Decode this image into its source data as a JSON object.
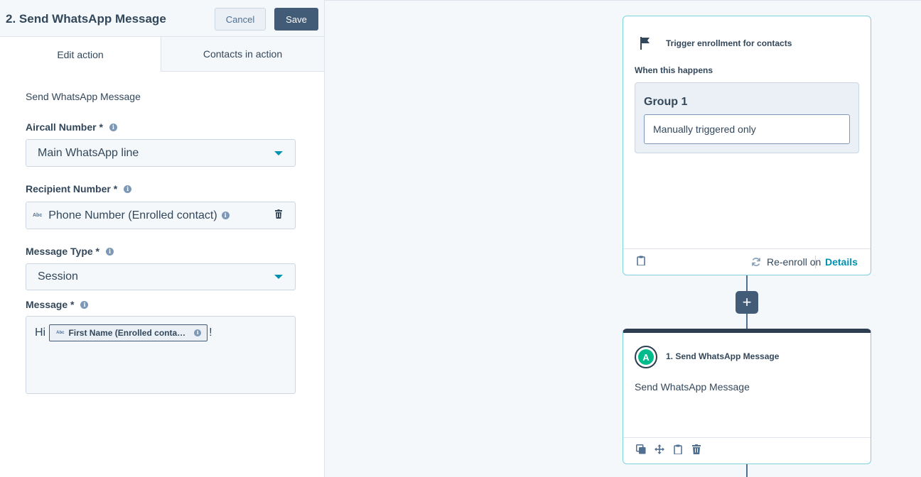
{
  "panel": {
    "title": "2. Send WhatsApp Message",
    "cancel_label": "Cancel",
    "save_label": "Save",
    "tabs": [
      {
        "label": "Edit action"
      },
      {
        "label": "Contacts in action"
      }
    ],
    "description": "Send WhatsApp Message",
    "aircall_number": {
      "label": "Aircall Number *",
      "value": "Main WhatsApp line"
    },
    "recipient_number": {
      "label": "Recipient Number *",
      "abc": "Abc",
      "value": "Phone Number (Enrolled contact)"
    },
    "message_type": {
      "label": "Message Type *",
      "value": "Session"
    },
    "message": {
      "label": "Message *",
      "prefix": "Hi",
      "token_abc": "Abc",
      "token": "First Name (Enrolled conta…",
      "suffix": "!"
    }
  },
  "canvas": {
    "trigger": {
      "title": "Trigger enrollment for contacts",
      "when": "When this happens",
      "group_title": "Group 1",
      "filter": "Manually triggered only",
      "reenroll": "Re-enroll on",
      "details": "Details"
    },
    "add_label": "+",
    "action": {
      "title": "1. Send WhatsApp Message",
      "description": "Send WhatsApp Message"
    }
  },
  "colors": {
    "accent": "#0091ae",
    "primary_button": "#425b76",
    "card_border": "#7fd1de",
    "action_header": "#2d3e50",
    "whatsapp_green": "#00bc8c"
  }
}
